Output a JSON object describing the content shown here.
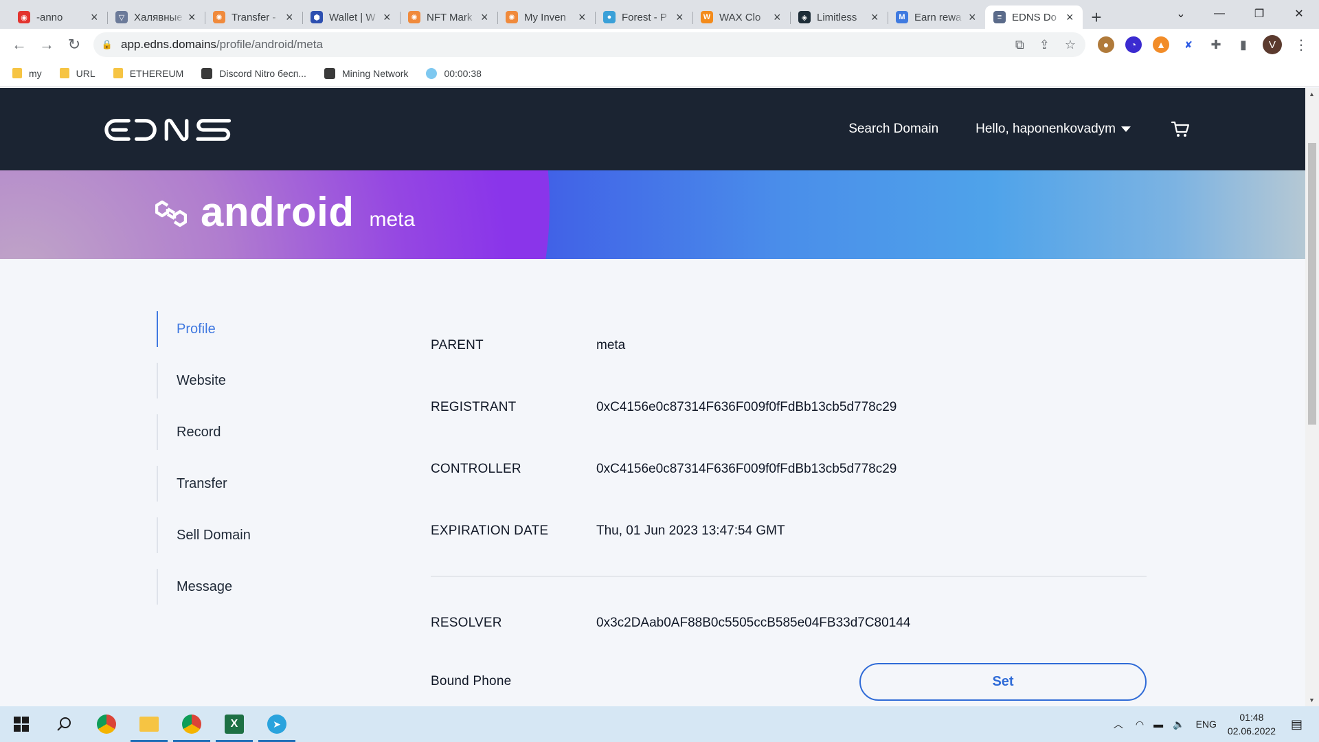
{
  "browser": {
    "tabs": [
      {
        "title": "-anno",
        "color": "#e3342f",
        "glyph": "◉"
      },
      {
        "title": "Халявные",
        "color": "#6b7a99",
        "glyph": "▽"
      },
      {
        "title": "Transfer -",
        "color": "#f08a3c",
        "glyph": "✺"
      },
      {
        "title": "Wallet | W",
        "color": "#2d4fb0",
        "glyph": "⬢"
      },
      {
        "title": "NFT Mark",
        "color": "#f08a3c",
        "glyph": "✺"
      },
      {
        "title": "My Inven",
        "color": "#f08a3c",
        "glyph": "✺"
      },
      {
        "title": "Forest - P",
        "color": "#3aa0d8",
        "glyph": "●"
      },
      {
        "title": "WAX Clo",
        "color": "#f38b1c",
        "glyph": "W"
      },
      {
        "title": "Limitless",
        "color": "#1e2d38",
        "glyph": "◈"
      },
      {
        "title": "Earn rewa",
        "color": "#3f7ae0",
        "glyph": "M"
      },
      {
        "title": "EDNS Do",
        "color": "#5b6b8a",
        "glyph": "≡"
      }
    ],
    "active_tab_index": 10,
    "new_tab_label": "+",
    "url_host": "app.edns.domains",
    "url_path": "/profile/android/meta",
    "profile_initial": "V",
    "bookmarks": [
      {
        "label": "my",
        "kind": "folder"
      },
      {
        "label": "URL",
        "kind": "folder"
      },
      {
        "label": "ETHEREUM",
        "kind": "folder"
      },
      {
        "label": "Discord Nitro бесп...",
        "kind": "site"
      },
      {
        "label": "Mining Network",
        "kind": "site"
      },
      {
        "label": "00:00:38",
        "kind": "globe"
      }
    ]
  },
  "site": {
    "logo_text": "EDNS",
    "nav": {
      "search_domain": "Search Domain",
      "greeting": "Hello, haponenkovadym"
    },
    "hero": {
      "domain_name": "android",
      "tld": "meta"
    },
    "menu": [
      {
        "label": "Profile",
        "active": true
      },
      {
        "label": "Website",
        "active": false
      },
      {
        "label": "Record",
        "active": false
      },
      {
        "label": "Transfer",
        "active": false
      },
      {
        "label": "Sell Domain",
        "active": false
      },
      {
        "label": "Message",
        "active": false
      }
    ],
    "details": {
      "parent_label": "PARENT",
      "parent_value": "meta",
      "registrant_label": "REGISTRANT",
      "registrant_value": "0xC4156e0c87314F636F009f0fFdBb13cb5d778c29",
      "controller_label": "CONTROLLER",
      "controller_value": "0xC4156e0c87314F636F009f0fFdBb13cb5d778c29",
      "expiration_label": "EXPIRATION DATE",
      "expiration_value": "Thu, 01 Jun 2023 13:47:54 GMT",
      "resolver_label": "RESOLVER",
      "resolver_value": "0x3c2DAab0AF88B0c5505ccB585e04FB33d7C80144",
      "bound_phone_label": "Bound Phone",
      "set_button": "Set"
    },
    "accent_color": "#3f78e0",
    "header_color": "#1b2432"
  },
  "taskbar": {
    "language": "ENG",
    "time": "01:48",
    "date": "02.06.2022"
  }
}
